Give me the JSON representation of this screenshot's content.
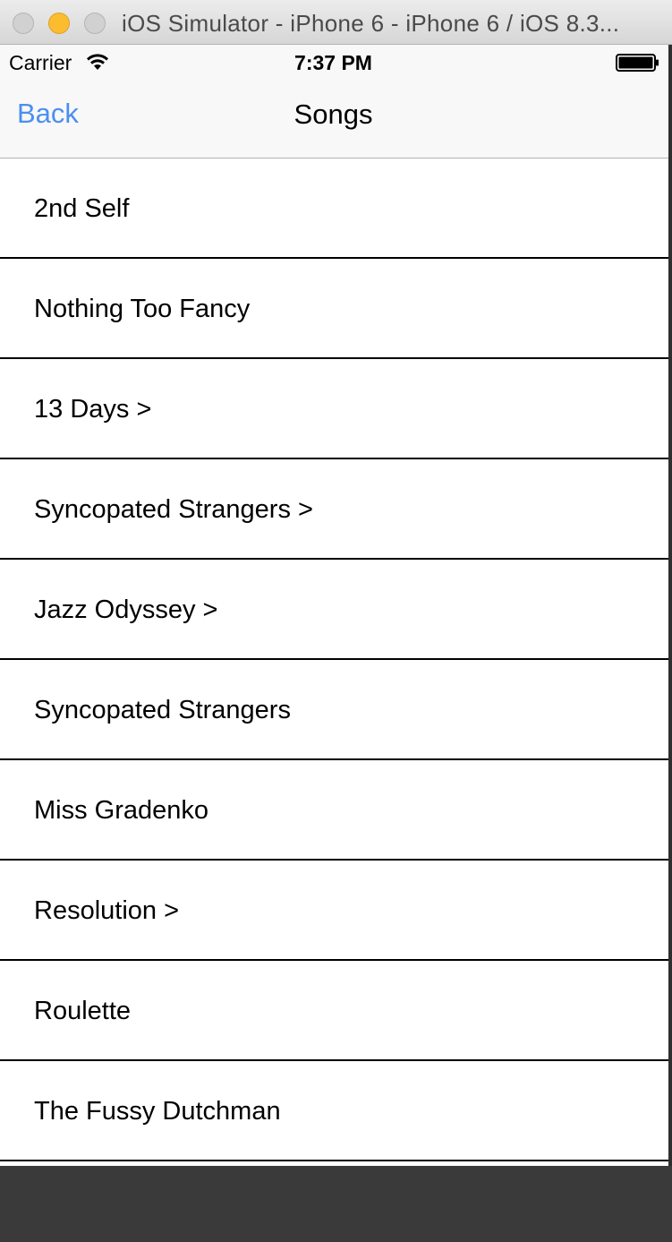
{
  "window": {
    "title": "iOS Simulator - iPhone 6 - iPhone 6 / iOS 8.3..."
  },
  "statusbar": {
    "carrier": "Carrier",
    "time": "7:37 PM",
    "wifi_icon": "wifi-icon",
    "battery_icon": "battery-icon"
  },
  "navbar": {
    "back_label": "Back",
    "title": "Songs"
  },
  "songs": [
    {
      "label": "2nd Self"
    },
    {
      "label": "Nothing Too Fancy"
    },
    {
      "label": "13 Days >"
    },
    {
      "label": "Syncopated Strangers >"
    },
    {
      "label": "Jazz Odyssey >"
    },
    {
      "label": "Syncopated Strangers"
    },
    {
      "label": "Miss Gradenko"
    },
    {
      "label": "Resolution >"
    },
    {
      "label": "Roulette"
    },
    {
      "label": "The Fussy Dutchman"
    }
  ],
  "colors": {
    "accent": "#4a8ff0",
    "minimize": "#fbbd2e"
  }
}
